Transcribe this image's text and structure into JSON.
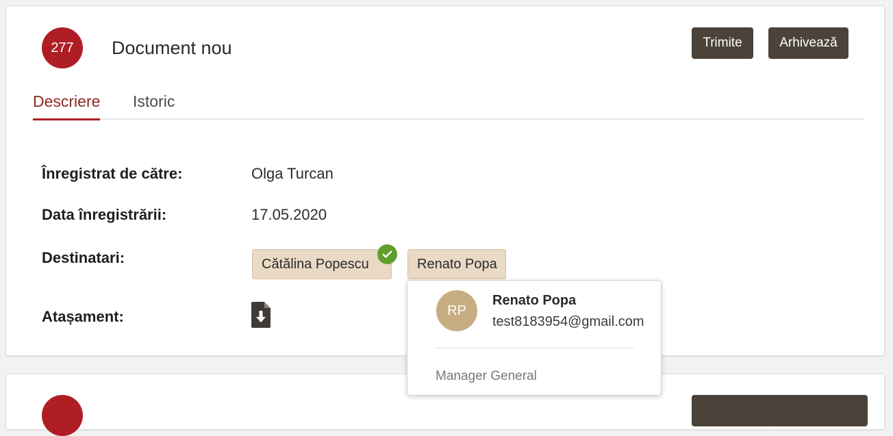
{
  "document": {
    "badge_number": "277",
    "title": "Document nou",
    "actions": {
      "send_label": "Trimite",
      "archive_label": "Arhivează"
    },
    "tabs": [
      {
        "label": "Descriere",
        "active": true
      },
      {
        "label": "Istoric",
        "active": false
      }
    ],
    "fields": {
      "registered_by_label": "Înregistrat de către:",
      "registered_by_value": "Olga Turcan",
      "registration_date_label": "Data înregistrării:",
      "registration_date_value": "17.05.2020",
      "recipients_label": "Destinatari:",
      "recipients": [
        {
          "name": "Cătălina Popescu",
          "confirmed": true
        },
        {
          "name": "Renato Popa",
          "confirmed": false
        }
      ],
      "attachment_label": "Atașament:",
      "attachment_icon": "file-download-icon"
    }
  },
  "recipient_popover": {
    "initials": "RP",
    "name": "Renato Popa",
    "email": "test8183954@gmail.com",
    "role": "Manager General"
  },
  "colors": {
    "badge": "#b01e25",
    "button": "#4b4339",
    "active_tab": "#8d2a22",
    "chip_bg": "#ead9c4",
    "check": "#5f9f2e",
    "avatar": "#c8ad82"
  }
}
